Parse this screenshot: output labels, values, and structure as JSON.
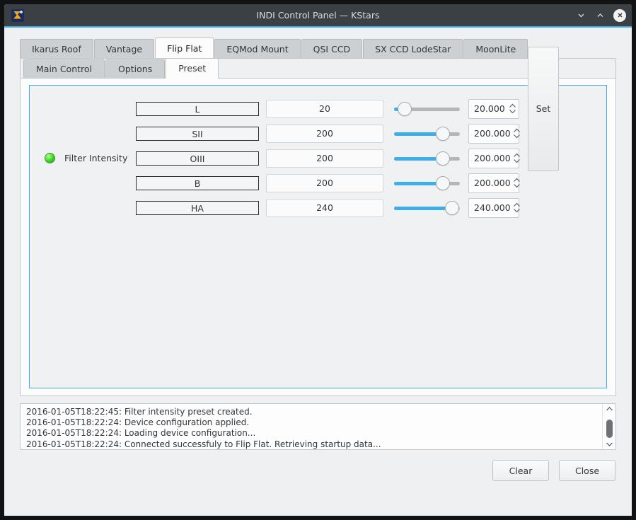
{
  "window": {
    "title": "INDI Control Panel — KStars",
    "app_icon": "kstars-icon",
    "minimize_icon": "chevron-down-icon",
    "maximize_icon": "chevron-up-icon",
    "close_icon": "close-icon",
    "accent_color": "#3daee9",
    "titlebar_color": "#3b4045"
  },
  "device_tabs": [
    {
      "label": "Ikarus Roof",
      "active": false
    },
    {
      "label": "Vantage",
      "active": false
    },
    {
      "label": "Flip Flat",
      "active": true
    },
    {
      "label": "EQMod Mount",
      "active": false
    },
    {
      "label": "QSI CCD",
      "active": false
    },
    {
      "label": "SX CCD LodeStar",
      "active": false
    },
    {
      "label": "MoonLite",
      "active": false
    }
  ],
  "sub_tabs": [
    {
      "label": "Main Control",
      "active": false
    },
    {
      "label": "Options",
      "active": false
    },
    {
      "label": "Preset",
      "active": true
    }
  ],
  "property": {
    "led_state": "ok",
    "led_color": "#49e02a",
    "label": "Filter Intensity",
    "set_label": "Set",
    "slider_min": 0,
    "slider_max": 255,
    "rows": [
      {
        "name": "L",
        "value": "20",
        "spin": "20.000",
        "slider": 20
      },
      {
        "name": "SII",
        "value": "200",
        "spin": "200.000",
        "slider": 200
      },
      {
        "name": "OIII",
        "value": "200",
        "spin": "200.000",
        "slider": 200
      },
      {
        "name": "B",
        "value": "200",
        "spin": "200.000",
        "slider": 200
      },
      {
        "name": "HA",
        "value": "240",
        "spin": "240.000",
        "slider": 240
      }
    ]
  },
  "log": {
    "lines": [
      "2016-01-05T18:22:45: Filter intensity preset created.",
      "2016-01-05T18:22:24: Device configuration applied.",
      "2016-01-05T18:22:24: Loading device configuration...",
      "2016-01-05T18:22:24: Connected successfuly to Flip Flat. Retrieving startup data..."
    ],
    "scroll_up_icon": "chevron-up-icon",
    "scroll_down_icon": "chevron-down-icon"
  },
  "footer": {
    "clear_label": "Clear",
    "close_label": "Close"
  }
}
